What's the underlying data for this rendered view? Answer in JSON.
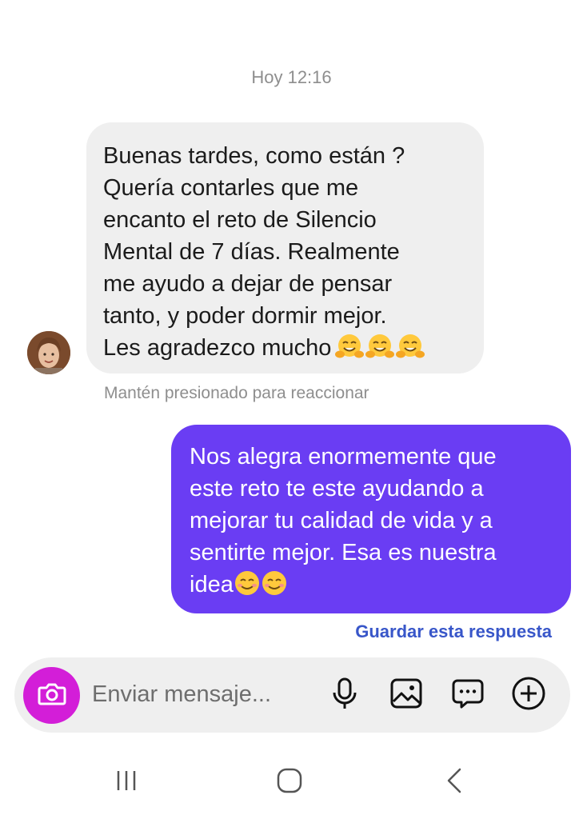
{
  "chat": {
    "timestamp": "Hoy 12:16",
    "incoming": {
      "text": "Buenas tardes, como están ?\nQuería contarles que me\nencanto el reto de Silencio\nMental de 7 días. Realmente\nme ayudo a dejar de pensar\ntanto, y poder dormir mejor.\nLes agradezco mucho",
      "emojis": [
        "hugging-face",
        "hugging-face",
        "hugging-face"
      ],
      "hint": "Mantén presionado para reaccionar"
    },
    "outgoing": {
      "text": "Nos alegra enormemente que\neste reto te este ayudando a\nmejorar tu calidad de vida y a\nsentirte mejor. Esa es nuestra\nidea",
      "emojis": [
        "smiling-face",
        "smiling-face"
      ],
      "save_reply": "Guardar esta respuesta"
    }
  },
  "composer": {
    "placeholder": "Enviar mensaje..."
  },
  "colors": {
    "incoming_bubble": "#efefef",
    "outgoing_bubble": "#6a3df3",
    "camera_button": "#d31ed8",
    "link": "#3856c9"
  },
  "icons": {
    "camera": "camera-icon",
    "mic": "microphone-icon",
    "gallery": "image-icon",
    "sticker": "chat-bubble-icon",
    "add": "plus-icon",
    "nav_recent": "recent-apps-icon",
    "nav_home": "home-icon",
    "nav_back": "back-icon"
  }
}
